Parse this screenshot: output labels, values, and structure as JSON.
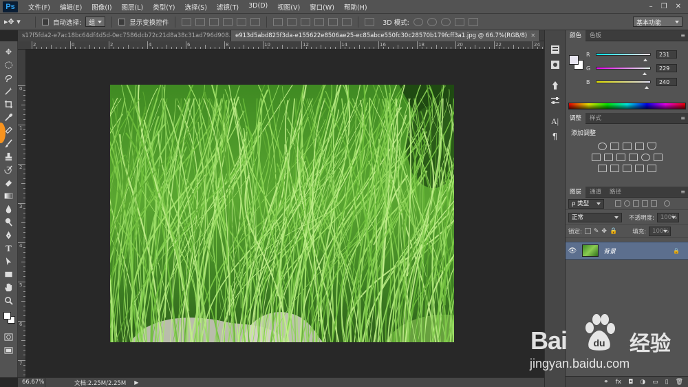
{
  "app": {
    "logo": "Ps"
  },
  "menu": [
    "文件(F)",
    "编辑(E)",
    "图像(I)",
    "图层(L)",
    "类型(Y)",
    "选择(S)",
    "滤镜(T)",
    "3D(D)",
    "视图(V)",
    "窗口(W)",
    "帮助(H)"
  ],
  "window_controls": {
    "minimize": "–",
    "restore": "❐",
    "close": "✕"
  },
  "options": {
    "tool_icon": "move-tool",
    "auto_select_label": "自动选择:",
    "auto_select_value": "组",
    "show_transform_label": "显示变换控件",
    "mode_3d_label": "3D 模式:",
    "workspace": "基本功能"
  },
  "tabs": [
    {
      "label": "s17f5fda2-e7ac18bc64df4d5d-0ec7586dcb72c21d8a38c31ad796d908.jpg",
      "active": false
    },
    {
      "label": "e913d5abd825f3da-e155622e8506ae25-ec85abce550fc30c28570b179fcff3a1.jpg @ 66.7%(RGB/8)",
      "active": true
    }
  ],
  "tab_close": "×",
  "ruler": {
    "top": [
      "2",
      "0",
      "2",
      "4",
      "6",
      "8",
      "10",
      "12",
      "14",
      "16",
      "18",
      "20",
      "22",
      "24",
      "26"
    ],
    "left": [
      "0",
      "1",
      "2",
      "3",
      "4",
      "5",
      "6",
      "7"
    ]
  },
  "status": {
    "zoom": "66.67%",
    "doc": "文档:2.25M/2.25M",
    "arrow": "▶"
  },
  "color_panel": {
    "tabs": [
      "颜色",
      "色板"
    ],
    "foreground": "#e7e5f0",
    "channels": [
      {
        "label": "R",
        "value": "231",
        "level": 0.906,
        "gradient": "linear-gradient(90deg,#00e5f0,#ffe5f0)"
      },
      {
        "label": "G",
        "value": "229",
        "level": 0.898,
        "gradient": "linear-gradient(90deg,#e700f0,#e7fff0)"
      },
      {
        "label": "B",
        "value": "240",
        "level": 0.941,
        "gradient": "linear-gradient(90deg,#e7e500,#e7e5ff)"
      }
    ]
  },
  "adjust_panel": {
    "tabs": [
      "调整",
      "样式"
    ],
    "title": "添加调整"
  },
  "layers_panel": {
    "tabs": [
      "图层",
      "通道",
      "路径"
    ],
    "filter": "ρ 类型",
    "blend_mode": "正常",
    "opacity_label": "不透明度:",
    "opacity_value": "100%",
    "lock_label": "锁定:",
    "fill_label": "填充:",
    "fill_value": "100%",
    "layer_name": "背景",
    "footer_icons": [
      "⚭",
      "fx",
      "◘",
      "◑",
      "▭",
      "▯",
      "🗑"
    ]
  },
  "watermark": {
    "brand": "Bai",
    "brand2": "经验",
    "url": "jingyan.baidu.com"
  }
}
